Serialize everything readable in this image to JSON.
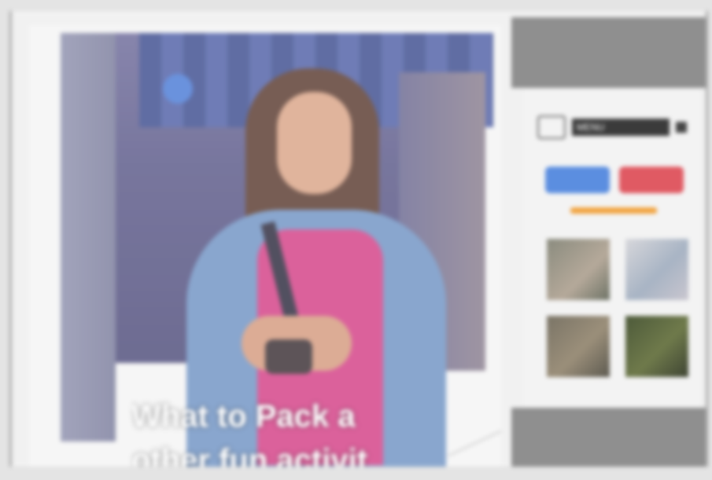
{
  "main": {
    "caption_line1": "What to Pack a",
    "caption_line2": "other fun activit"
  },
  "sidebar": {
    "toolbar_label": "MENU",
    "blue_button": "",
    "red_button": "",
    "orange_link": "",
    "thumbnails": [
      "thumb-1",
      "thumb-2",
      "thumb-3",
      "thumb-4"
    ]
  },
  "colors": {
    "accent_blue": "#5b8ee0",
    "accent_red": "#e05a63",
    "accent_orange": "#f2a23c",
    "sidebar_gray": "#8f8f8f"
  },
  "icons": [
    "toggle-icon",
    "small-square-icon",
    "logo-icon"
  ]
}
